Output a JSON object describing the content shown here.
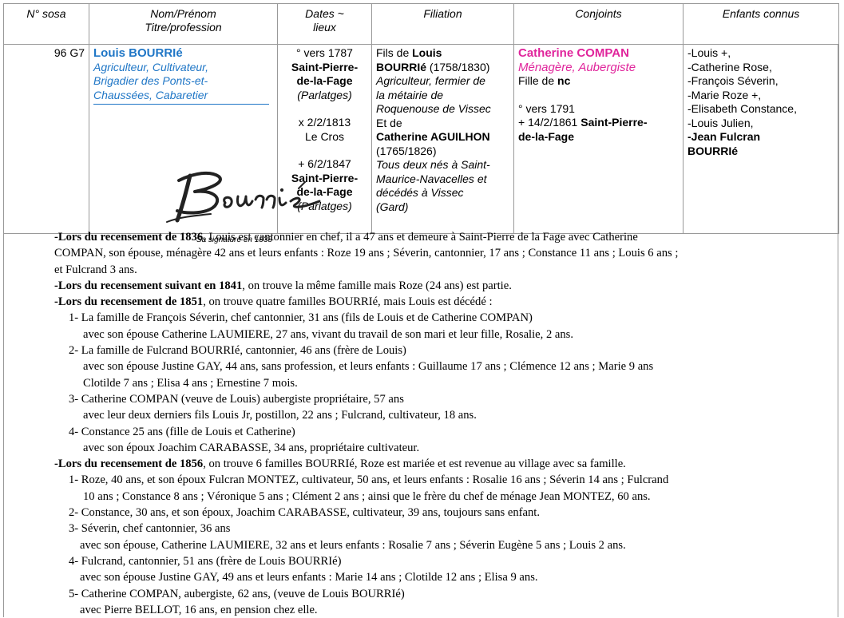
{
  "headers": {
    "sosa": "N° sosa",
    "nom_line1": "Nom/Prénom",
    "nom_line2": "Titre/profession",
    "dates_line1": "Dates ~",
    "dates_line2": "lieux",
    "filiation": "Filiation",
    "conjoints": "Conjoints",
    "enfants": "Enfants connus"
  },
  "person": {
    "sosa": "96 G7",
    "firstname": "Louis ",
    "lastname": "BOURRIé",
    "professions": [
      "Agriculteur, Cultivateur,",
      "Brigadier des Ponts-et-",
      "Chaussées, Cabaretier"
    ],
    "signature_text": "Bourrié",
    "signature_caption": "Sa signature en 1838"
  },
  "dates": {
    "birth_line": "° vers 1787",
    "birth_place": [
      "Saint-Pierre-",
      "de-la-Fage"
    ],
    "birth_sub": "(Parlatges)",
    "marriage_line": "x 2/2/1813",
    "marriage_place": "Le Cros",
    "death_line": "+ 6/2/1847",
    "death_place": [
      "Saint-Pierre-",
      "de-la-Fage"
    ],
    "death_sub": "(Parlatges)"
  },
  "filiation": {
    "father_prefix": "Fils de ",
    "father_first": "Louis",
    "father_last": "BOURRIé",
    "father_years": " (1758/1830)",
    "father_prof": [
      "Agriculteur, fermier de",
      "la métairie de",
      "Roquenouse de Vissec"
    ],
    "and": "Et de",
    "mother_name": "Catherine AGUILHON",
    "mother_years": "(1765/1826)",
    "note": [
      "Tous deux nés à Saint-",
      "Maurice-Navacelles et",
      "décédés à Vissec",
      "(Gard)"
    ]
  },
  "conjoint": {
    "name": "Catherine COMPAN",
    "prof": "Ménagère, Aubergiste",
    "daughter_prefix": "Fille de ",
    "daughter_of": "nc",
    "birth": "° vers 1791",
    "death_prefix": "+ 14/2/1861 ",
    "death_place_1": "Saint-Pierre-",
    "death_place_2": "de-la-Fage"
  },
  "enfants": {
    "list": [
      "-Louis +,",
      "-Catherine Rose,",
      "-François Séverin,",
      "-Marie Roze +,",
      "-Elisabeth Constance,",
      "-Louis Julien,"
    ],
    "last_1": "-Jean Fulcran",
    "last_2": "BOURRIé"
  },
  "notes": {
    "n1_bold": "-Lors du recensement de 1836",
    "n1_rest": ", Louis est cantonnier en chef, il a 47 ans et demeure à Saint-Pierre de la Fage avec Catherine",
    "n1_l2": "COMPAN, son épouse, ménagère 42 ans et leurs enfants : Roze 19 ans ; Séverin, cantonnier, 17 ans ; Constance 11 ans ; Louis 6 ans ;",
    "n1_l3": "et Fulcrand 3 ans.",
    "n2_bold": "-Lors du recensement suivant en 1841",
    "n2_rest": ", on trouve la même famille mais Roze (24 ans) est partie.",
    "n3_bold": "-Lors du recensement de 1851",
    "n3_rest": ", on trouve quatre familles BOURRIé, mais Louis est décédé :",
    "f1_a": "1- La famille de François Séverin, chef cantonnier, 31 ans (fils de Louis et de Catherine COMPAN)",
    "f1_b": "avec son épouse Catherine LAUMIERE, 27 ans, vivant du travail de son mari et leur fille, Rosalie, 2 ans.",
    "f2_a": "2- La famille de Fulcrand BOURRIé, cantonnier, 46 ans (frère de Louis)",
    "f2_b": "avec son épouse Justine GAY, 44 ans, sans profession, et leurs enfants : Guillaume 17 ans ; Clémence 12 ans ; Marie 9 ans",
    "f2_c": "Clotilde 7 ans ; Elisa 4 ans ; Ernestine 7 mois.",
    "f3_a": "3- Catherine COMPAN (veuve de Louis) aubergiste propriétaire, 57 ans",
    "f3_b": "avec leur deux derniers fils Louis Jr, postillon, 22 ans ; Fulcrand, cultivateur, 18 ans.",
    "f4_a": "4- Constance 25 ans (fille de Louis et Catherine)",
    "f4_b": "avec son époux Joachim CARABASSE, 34 ans, propriétaire cultivateur.",
    "n4_bold": "-Lors du recensement de 1856",
    "n4_rest": ", on trouve 6 familles BOURRIé, Roze est mariée et est revenue au village avec sa famille.",
    "g1_a": "1- Roze, 40 ans, et son époux Fulcran MONTEZ, cultivateur, 50 ans, et leurs enfants : Rosalie 16 ans ; Séverin 14 ans ; Fulcrand",
    "g1_b": "10 ans ; Constance 8 ans ; Véronique 5 ans ; Clément 2 ans ; ainsi que le frère du chef de ménage Jean MONTEZ, 60 ans.",
    "g2_a": "2- Constance, 30 ans, et son époux, Joachim CARABASSE, cultivateur, 39 ans, toujours sans enfant.",
    "g3_a": "3- Séverin, chef cantonnier, 36 ans",
    "g3_b": "avec son épouse, Catherine LAUMIERE, 32 ans et leurs enfants : Rosalie 7 ans ; Séverin Eugène 5 ans ; Louis 2 ans.",
    "g4_a": "4- Fulcrand, cantonnier, 51 ans (frère de Louis BOURRIé)",
    "g4_b": "avec son épouse Justine GAY, 49 ans et leurs enfants : Marie 14 ans ; Clotilde 12 ans ; Elisa 9 ans.",
    "g5_a": "5- Catherine COMPAN, aubergiste, 62 ans, (veuve de Louis BOURRIé)",
    "g5_b": "avec Pierre BELLOT, 16 ans, en pension chez elle."
  }
}
